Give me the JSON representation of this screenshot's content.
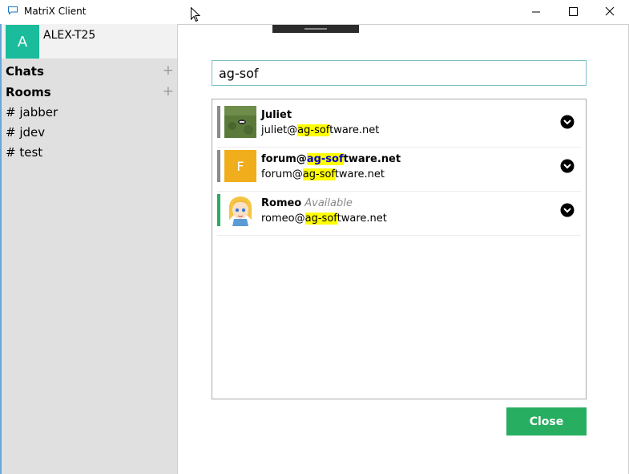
{
  "window": {
    "title": "MatriX Client"
  },
  "account": {
    "initial": "A",
    "name": "ALEX-T25"
  },
  "sidebar": {
    "chats_label": "Chats",
    "rooms_label": "Rooms",
    "add_symbol": "+",
    "rooms": [
      {
        "prefix": "#",
        "name": "jabber"
      },
      {
        "prefix": "#",
        "name": "jdev"
      },
      {
        "prefix": "#",
        "name": "test"
      }
    ]
  },
  "search": {
    "value": "ag-sof"
  },
  "results": [
    {
      "name": "Juliet",
      "status": "",
      "address_pre": "juliet@",
      "address_match": "ag-sof",
      "address_post": "tware.net",
      "bar_color": "#8a8a8a",
      "avatar": "photo"
    },
    {
      "name_pre": "forum@",
      "name_match": "ag-sof",
      "name_post": "tware.net",
      "initial": "F",
      "address_pre": "forum@",
      "address_match": "ag-sof",
      "address_post": "tware.net",
      "bar_color": "#8a8a8a",
      "avatar_color": "#f0ad1c"
    },
    {
      "name": "Romeo",
      "status": "Available",
      "address_pre": "romeo@",
      "address_match": "ag-sof",
      "address_post": "tware.net",
      "bar_color": "#27ae60",
      "avatar": "cartoon"
    }
  ],
  "buttons": {
    "close": "Close"
  },
  "colors": {
    "accent_green": "#27ae60",
    "avatar_teal": "#1abc9c",
    "highlight": "#ffff00"
  }
}
